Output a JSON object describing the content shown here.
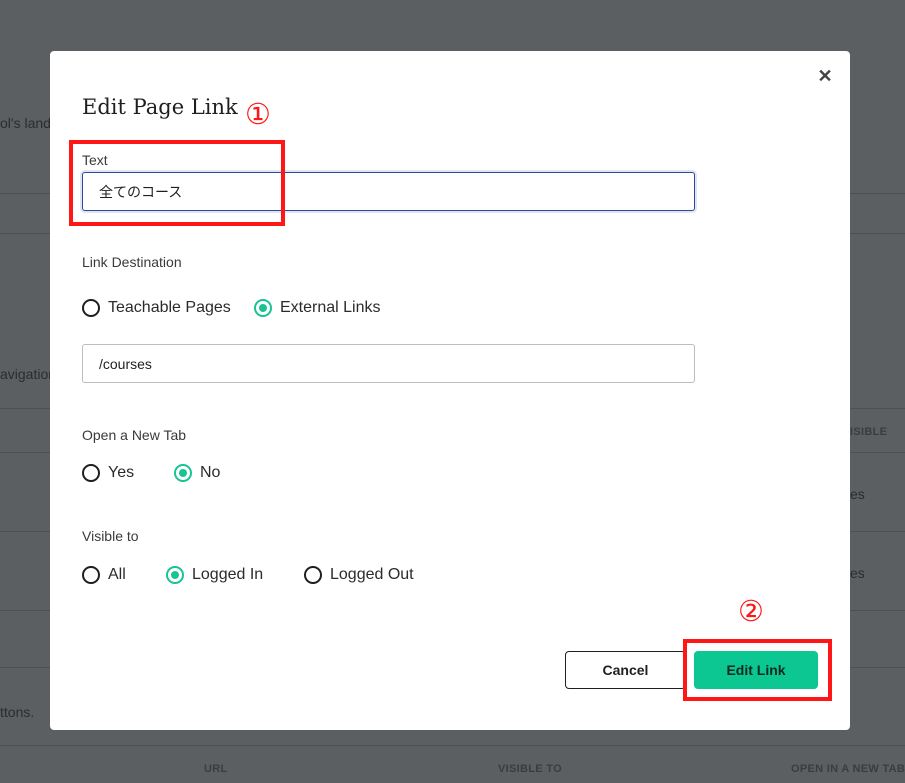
{
  "background": {
    "fragment_landing": "ol's landi",
    "fragment_navigation": "avigation",
    "fragment_visible": "ISIBLE",
    "fragment_yes_1": "es",
    "fragment_yes_2": "es",
    "fragment_buttons": "ttons.",
    "col_url": "URL",
    "col_visible_to": "VISIBLE TO",
    "col_open_new_tab": "OPEN IN A NEW TAB"
  },
  "modal": {
    "title": "Edit Page Link",
    "close_icon": "close-icon",
    "text_label": "Text",
    "text_value": "全てのコース",
    "link_destination_label": "Link Destination",
    "link_destination_options": [
      {
        "label": "Teachable Pages",
        "selected": false
      },
      {
        "label": "External Links",
        "selected": true
      }
    ],
    "url_value": "/courses",
    "new_tab_label": "Open a New Tab",
    "new_tab_options": [
      {
        "label": "Yes",
        "selected": false
      },
      {
        "label": "No",
        "selected": true
      }
    ],
    "visible_to_label": "Visible to",
    "visible_to_options": [
      {
        "label": "All",
        "selected": false
      },
      {
        "label": "Logged In",
        "selected": true
      },
      {
        "label": "Logged Out",
        "selected": false
      }
    ],
    "cancel_label": "Cancel",
    "edit_label": "Edit Link"
  },
  "annotations": {
    "marker_1": "①",
    "marker_2": "②"
  },
  "colors": {
    "accent": "#19c394",
    "button_green": "#0dc793",
    "annotation_red": "#ff1616",
    "overlay": "#5c5f61"
  }
}
